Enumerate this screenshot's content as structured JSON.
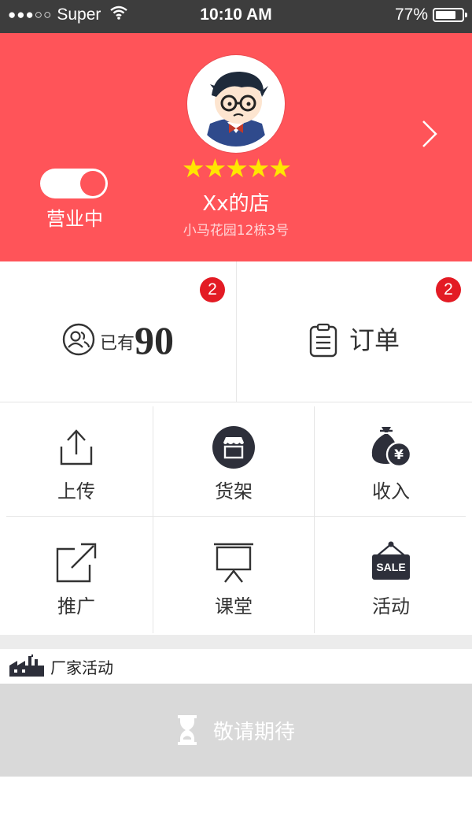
{
  "status_bar": {
    "signal_dots": "●●●○○",
    "carrier": "Super",
    "time": "10:10 AM",
    "battery_percent": "77%",
    "battery_level": 0.77
  },
  "shop": {
    "rating_stars": "★★★★★",
    "rating": 5,
    "name": "Xx的店",
    "address": "小马花园12栋3号",
    "open_status_label": "营业中",
    "is_open": true
  },
  "stats": {
    "customers": {
      "badge": "2",
      "prefix": "已有",
      "count": "90"
    },
    "orders": {
      "badge": "2",
      "label": "订单"
    }
  },
  "grid": {
    "upload": "上传",
    "shelf": "货架",
    "income": "收入",
    "promote": "推广",
    "classroom": "课堂",
    "activity": "活动",
    "sale_sign": "SALE"
  },
  "factory": {
    "label": "厂家活动"
  },
  "coming_soon": {
    "label": "敬请期待"
  },
  "colors": {
    "brand": "#ff5459",
    "badge": "#e31b24",
    "stars": "#ffe600",
    "icon_dark": "#2d2f3a"
  }
}
